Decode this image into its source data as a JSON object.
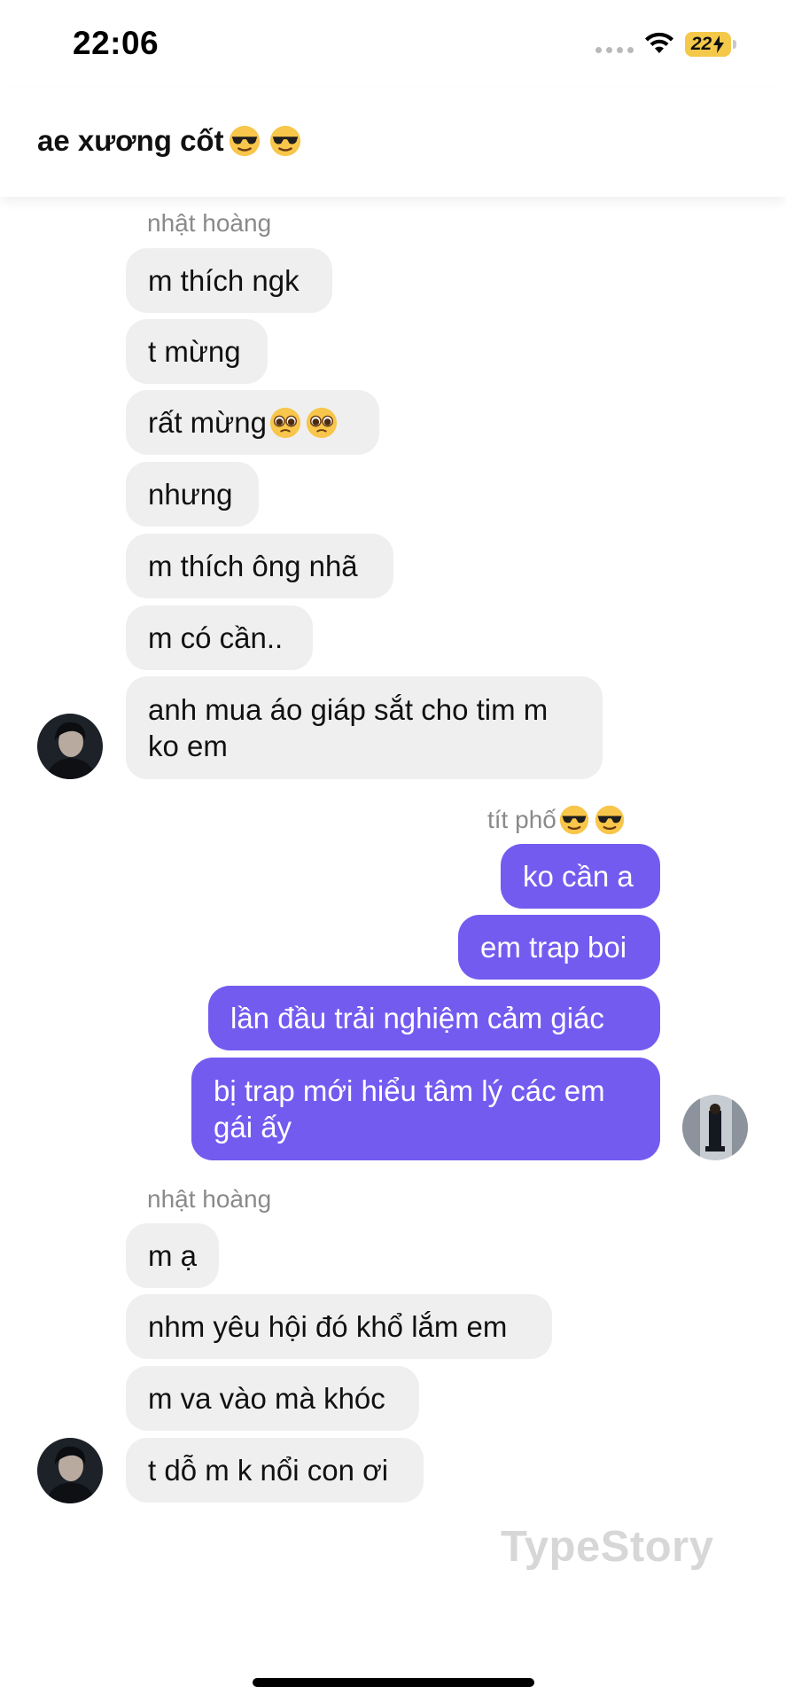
{
  "status_bar": {
    "time": "22:06",
    "battery": "22"
  },
  "header": {
    "title": "ae xương cốt",
    "title_emojis": [
      "sunglasses-emoji",
      "sunglasses-emoji"
    ]
  },
  "groups": [
    {
      "sender": "nhật hoàng",
      "direction": "incoming",
      "messages": [
        "m thích ngk",
        "t mừng",
        "rất mừng",
        "nhưng",
        "m thích ông nhã",
        "m có cần..",
        "anh mua áo giáp sắt cho tim m\nko em"
      ]
    },
    {
      "sender": "tít phố",
      "direction": "outgoing",
      "messages": [
        "ko cần a",
        "em trap boi",
        "lần đầu trải nghiệm cảm giác",
        "bị trap mới hiểu tâm lý các em\ngái ấy"
      ]
    },
    {
      "sender": "nhật hoàng",
      "direction": "incoming",
      "messages": [
        "m ạ",
        "nhm yêu hội đó khổ lắm em",
        "m va vào mà khóc",
        "t dỗ m k nổi con ơi"
      ]
    }
  ],
  "watermark": "TypeStory",
  "colors": {
    "incoming_bubble": "#efefef",
    "outgoing_bubble": "#745bf0",
    "sender_name": "#8a8a8a"
  }
}
